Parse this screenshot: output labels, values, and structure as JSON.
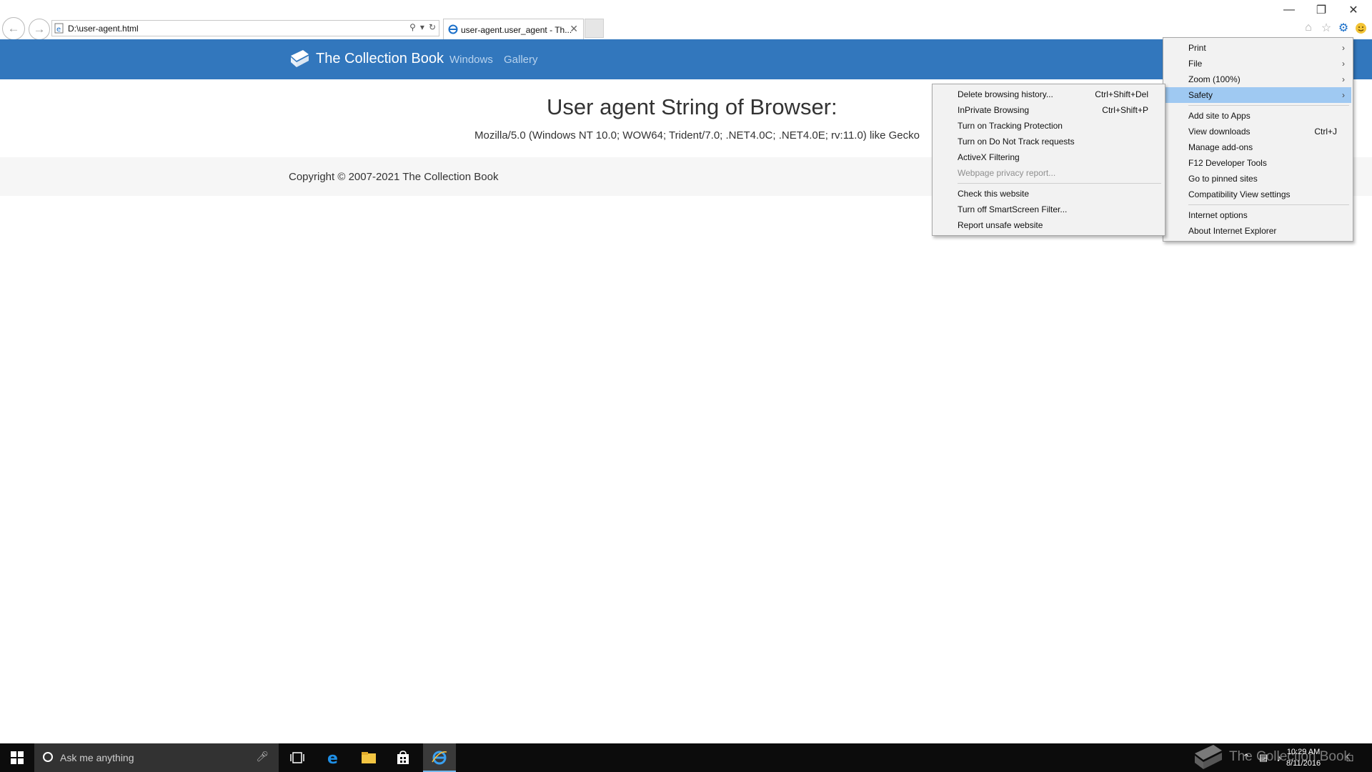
{
  "browser": {
    "address": "D:\\user-agent.html",
    "tab_title": "user-agent.user_agent - Th...",
    "window_controls": [
      "minimize-icon",
      "restore-icon",
      "close-icon"
    ],
    "command_icons": [
      "home-icon",
      "favorites-star-icon",
      "tools-gear-icon",
      "feedback-smiley-icon"
    ]
  },
  "site": {
    "brand": "The Collection Book",
    "nav": [
      "Windows",
      "Gallery"
    ],
    "heading": "User agent String of Browser:",
    "user_agent": "Mozilla/5.0 (Windows NT 10.0; WOW64; Trident/7.0; .NET4.0C; .NET4.0E; rv:11.0) like Gecko",
    "copyright": "Copyright © 2007-2021 The Collection Book"
  },
  "tools_menu": {
    "items": [
      {
        "label": "Print",
        "submenu": true
      },
      {
        "label": "File",
        "submenu": true
      },
      {
        "label": "Zoom (100%)",
        "submenu": true
      },
      {
        "label": "Safety",
        "submenu": true,
        "highlighted": true
      },
      {
        "label": "Add site to Apps"
      },
      {
        "label": "View downloads",
        "shortcut": "Ctrl+J"
      },
      {
        "label": "Manage add-ons"
      },
      {
        "label": "F12 Developer Tools"
      },
      {
        "label": "Go to pinned sites"
      },
      {
        "label": "Compatibility View settings"
      },
      {
        "label": "Internet options"
      },
      {
        "label": "About Internet Explorer"
      }
    ]
  },
  "safety_menu": {
    "items": [
      {
        "label": "Delete browsing history...",
        "shortcut": "Ctrl+Shift+Del"
      },
      {
        "label": "InPrivate Browsing",
        "shortcut": "Ctrl+Shift+P"
      },
      {
        "label": "Turn on Tracking Protection"
      },
      {
        "label": "Turn on Do Not Track requests"
      },
      {
        "label": "ActiveX Filtering"
      },
      {
        "label": "Webpage privacy report...",
        "disabled": true
      },
      {
        "label": "Check this website"
      },
      {
        "label": "Turn off SmartScreen Filter..."
      },
      {
        "label": "Report unsafe website"
      }
    ]
  },
  "taskbar": {
    "search_placeholder": "Ask me anything",
    "time": "10:29 AM",
    "date": "8/11/2016",
    "watermark": "The Collection Book",
    "pinned": [
      "task-view-icon",
      "edge-icon",
      "file-explorer-icon",
      "store-icon",
      "internet-explorer-icon"
    ]
  },
  "colors": {
    "navbar": "#3277bd",
    "menu_highlight": "#9fc9f2",
    "taskbar": "#0c0c0c"
  }
}
